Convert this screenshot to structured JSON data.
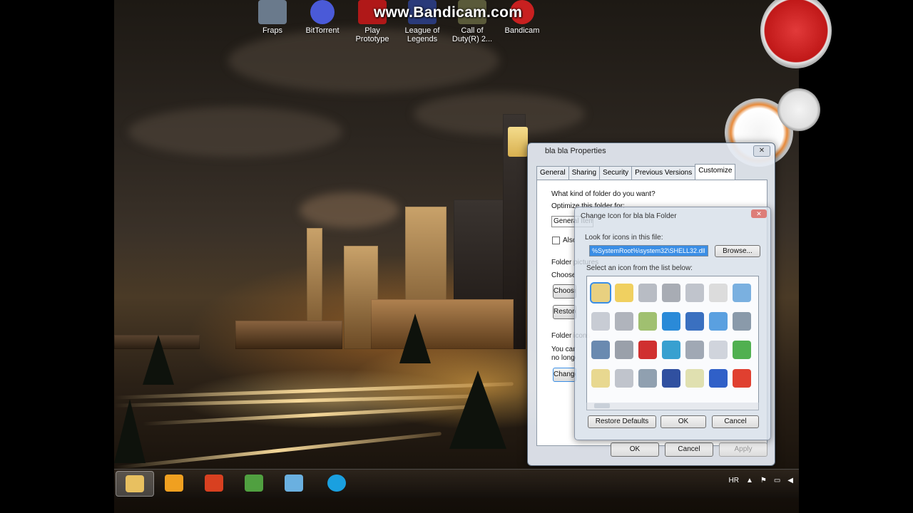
{
  "watermark": "www.Bandicam.com",
  "desktop_icons": [
    {
      "label": "Fraps",
      "color": "#6a7a8c"
    },
    {
      "label": "BitTorrent",
      "color": "#4a5ad8"
    },
    {
      "label": "Play Prototype",
      "color": "#b01818"
    },
    {
      "label": "League of Legends",
      "color": "#2a3a7a"
    },
    {
      "label": "Call of Duty(R) 2...",
      "color": "#5a5a3a"
    },
    {
      "label": "Bandicam",
      "color": "#c82020"
    }
  ],
  "properties": {
    "title": "bla bla Properties",
    "tabs": [
      "General",
      "Sharing",
      "Security",
      "Previous Versions",
      "Customize"
    ],
    "active_tab": "Customize",
    "what_kind": "What kind of folder do you want?",
    "optimize": "Optimize this folder for:",
    "optimize_value": "General Items",
    "also_apply": "Also apply this template to all subfolders",
    "folder_pictures": "Folder pictures",
    "choose_file": "Choose a file to show on this folder icon.",
    "choose_btn": "Choose File...",
    "restore_default": "Restore Default",
    "folder_icons": "Folder icons",
    "icons_text_1": "You can change the folder icon. If you change it, you will",
    "icons_text_2": "no longer see a preview of the folder's contents.",
    "change_icon": "Change Icon...",
    "ok": "OK",
    "cancel": "Cancel",
    "apply": "Apply"
  },
  "change_icon_dialog": {
    "title": "Change Icon for bla bla Folder",
    "look_for": "Look for icons in this file:",
    "file_value": "%SystemRoot%\\system32\\SHELL32.dll",
    "browse": "Browse...",
    "select_label": "Select an icon from the list below:",
    "restore_defaults": "Restore Defaults",
    "ok": "OK",
    "cancel": "Cancel",
    "icon_colors": [
      "#e8d080",
      "#f0d060",
      "#b8bcc4",
      "#a8acb4",
      "#c0c4cc",
      "#dcdcdc",
      "#7ab0e0",
      "#c8ccd4",
      "#b0b4bc",
      "#a0c070",
      "#2a8ad8",
      "#3a70c0",
      "#5aa0e0",
      "#8a9aaa",
      "#6a8ab0",
      "#9aa0aa",
      "#d03030",
      "#38a0d0",
      "#a0a8b4",
      "#d0d4dc",
      "#50b050",
      "#e8d890",
      "#c0c4cc",
      "#90a0b0",
      "#3050a0",
      "#e0e0b0",
      "#3060c8",
      "#e04030"
    ]
  },
  "taskbar": {
    "items": [
      "Windows Explorer",
      "Media Player",
      "Firefox",
      "Paint",
      "Desktop App",
      "Skype"
    ],
    "colors": [
      "#e8c060",
      "#f0a020",
      "#d84020",
      "#50a040",
      "#6ab0e0",
      "#1aa0e0"
    ],
    "language": "HR"
  }
}
